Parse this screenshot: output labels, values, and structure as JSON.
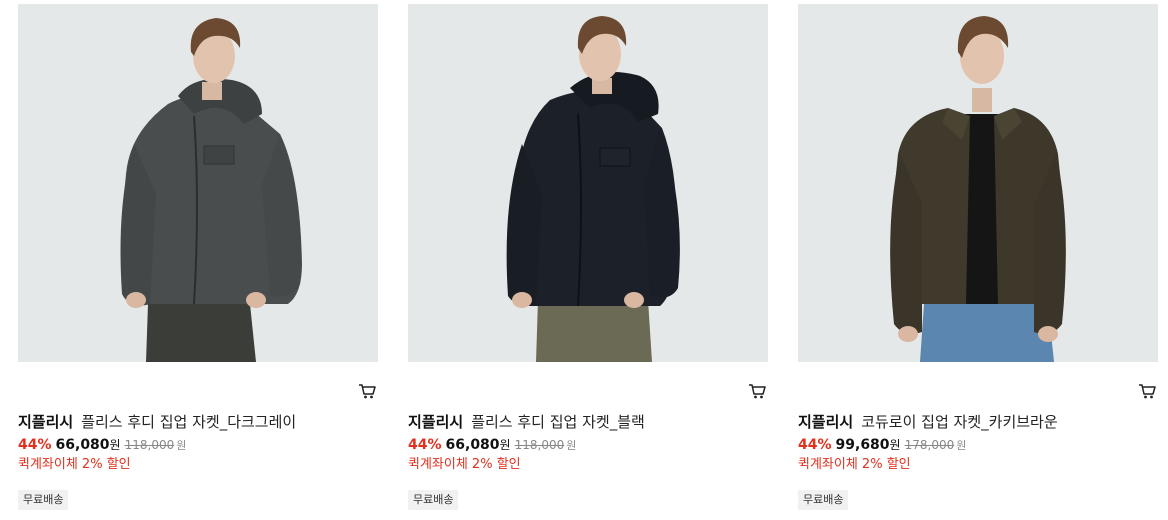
{
  "products": [
    {
      "brand": "지플리시",
      "name": "플리스 후디 집업 자켓_다크그레이",
      "discount": "44%",
      "price": "66,080",
      "price_unit": "원",
      "original_price": "118,000",
      "original_unit": "원",
      "benefit": "퀵계좌이체 2% 할인",
      "badge": "무료배송",
      "image": "gray-fleece-hoodie-model",
      "cart_icon": "cart-icon",
      "colors": {
        "garment": "#4a4d4d",
        "pants": "#3b3d38"
      }
    },
    {
      "brand": "지플리시",
      "name": "플리스 후디 집업 자켓_블랙",
      "discount": "44%",
      "price": "66,080",
      "price_unit": "원",
      "original_price": "118,000",
      "original_unit": "원",
      "benefit": "퀵계좌이체 2% 할인",
      "badge": "무료배송",
      "image": "black-fleece-hoodie-model",
      "cart_icon": "cart-icon",
      "colors": {
        "garment": "#1c2129",
        "pants": "#6b6a55"
      }
    },
    {
      "brand": "지플리시",
      "name": "코듀로이 집업 자켓_카키브라운",
      "discount": "44%",
      "price": "99,680",
      "price_unit": "원",
      "original_price": "178,000",
      "original_unit": "원",
      "benefit": "퀵계좌이체 2% 할인",
      "badge": "무료배송",
      "image": "khaki-brown-corduroy-jacket-model",
      "cart_icon": "cart-icon",
      "colors": {
        "garment": "#3f3a2c",
        "pants": "#5a86b0"
      }
    }
  ],
  "accent_color": "#e0301e"
}
